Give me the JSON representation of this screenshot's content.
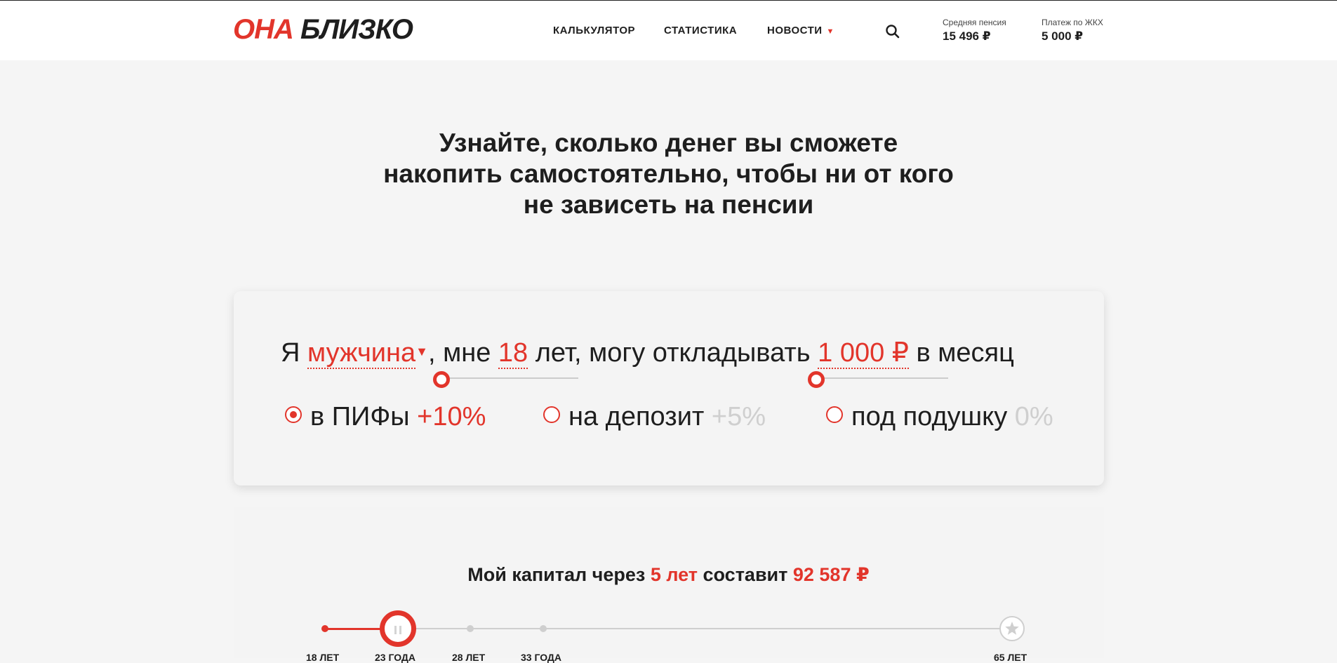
{
  "header": {
    "logo_part1": "ОНА",
    "logo_part2": "БЛИЗКО",
    "nav": [
      {
        "label": "КАЛЬКУЛЯТОР"
      },
      {
        "label": "СТАТИСТИКА"
      },
      {
        "label": "НОВОСТИ"
      }
    ],
    "stats": [
      {
        "label": "Средняя пенсия",
        "value": "15 496 ₽"
      },
      {
        "label": "Платеж по ЖКХ",
        "value": "5 000 ₽"
      }
    ]
  },
  "headline": {
    "line1": "Узнайте, сколько денег вы сможете",
    "line2": "накопить самостоятельно, чтобы ни от кого",
    "line3": "не зависеть на пенсии"
  },
  "calculator": {
    "prefix": "Я",
    "gender": "мужчина",
    "mid1": ", мне",
    "age": "18",
    "mid2": "лет, могу откладывать",
    "amount": "1 000 ₽",
    "suffix": "в месяц",
    "options": [
      {
        "label": "в ПИФы",
        "rate": "+10%",
        "selected": true
      },
      {
        "label": "на депозит",
        "rate": "+5%",
        "selected": false
      },
      {
        "label": "под подушку",
        "rate": "0%",
        "selected": false
      }
    ]
  },
  "result": {
    "prefix": "Мой капитал через",
    "years": "5 лет",
    "mid": "составит",
    "amount": "92 587 ₽"
  },
  "timeline": {
    "labels": [
      "18 ЛЕТ",
      "23 ГОДА",
      "28 ЛЕТ",
      "33 ГОДА",
      "65 ЛЕТ"
    ]
  },
  "colors": {
    "accent": "#e2352b",
    "text": "#1e1e1e",
    "muted": "#cfcfcf",
    "background": "#f5f5f5"
  },
  "icons": [
    "search-icon",
    "dropdown-arrow-icon",
    "pause-icon",
    "star-icon"
  ]
}
